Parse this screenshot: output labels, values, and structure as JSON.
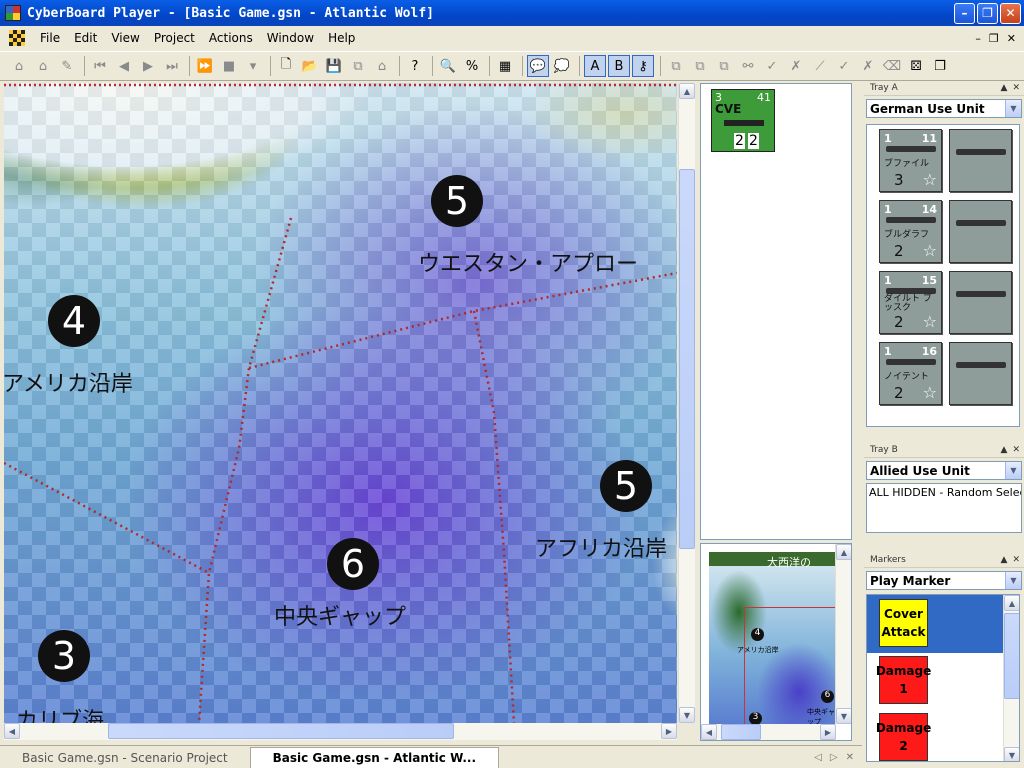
{
  "window": {
    "title": "CyberBoard Player - [Basic Game.gsn - Atlantic Wolf]"
  },
  "menu": [
    "File",
    "Edit",
    "View",
    "Project",
    "Actions",
    "Window",
    "Help"
  ],
  "map": {
    "zones": [
      {
        "num": "5",
        "label": "ウエスタン・アプロー"
      },
      {
        "num": "4",
        "label": "アメリカ沿岸"
      },
      {
        "num": "5",
        "label": "アフリカ沿岸"
      },
      {
        "num": "6",
        "label": "中央ギャップ"
      },
      {
        "num": "3",
        "label": "カリブ海"
      }
    ]
  },
  "selection": {
    "counter": {
      "tl": "3",
      "tr": "41",
      "name": "CVE",
      "bl": "2",
      "br": "2"
    }
  },
  "overview": {
    "title": "大西洋の",
    "z4": "4",
    "z4label": "アメリカ沿岸",
    "z6": "6",
    "z6label": "中央ギャップ",
    "z3": "3"
  },
  "trayA": {
    "header": "Tray A",
    "selected": "German Use Unit",
    "units": [
      {
        "num": "1",
        "val": "11",
        "name": "ブファイル",
        "bn": "3",
        "star": "☆"
      },
      {
        "num": "1",
        "val": "14",
        "name": "ブルダラフ",
        "bn": "2",
        "star": "☆"
      },
      {
        "num": "1",
        "val": "15",
        "name": "ダイルト ブッスク",
        "bn": "2",
        "star": "☆"
      },
      {
        "num": "1",
        "val": "16",
        "name": "ノイテント",
        "bn": "2",
        "star": "☆"
      }
    ]
  },
  "trayB": {
    "header": "Tray B",
    "selected": "Allied Use Unit",
    "content": "ALL HIDDEN - Random Selectio"
  },
  "markers": {
    "header": "Markers",
    "selected": "Play Marker",
    "items": [
      {
        "l1": "Cover",
        "l2": "Attack",
        "color": "#ffff00"
      },
      {
        "l1": "Damage",
        "l2": "1",
        "color": "#ff1a1a"
      },
      {
        "l1": "Damage",
        "l2": "2",
        "color": "#ff1a1a"
      }
    ]
  },
  "tabs": [
    "Basic Game.gsn - Scenario Project",
    "Basic Game.gsn - Atlantic W..."
  ],
  "colors": {
    "titlebar": "#0a5fe6",
    "accent": "#316ac5",
    "dotted_border": "#c0282d"
  }
}
